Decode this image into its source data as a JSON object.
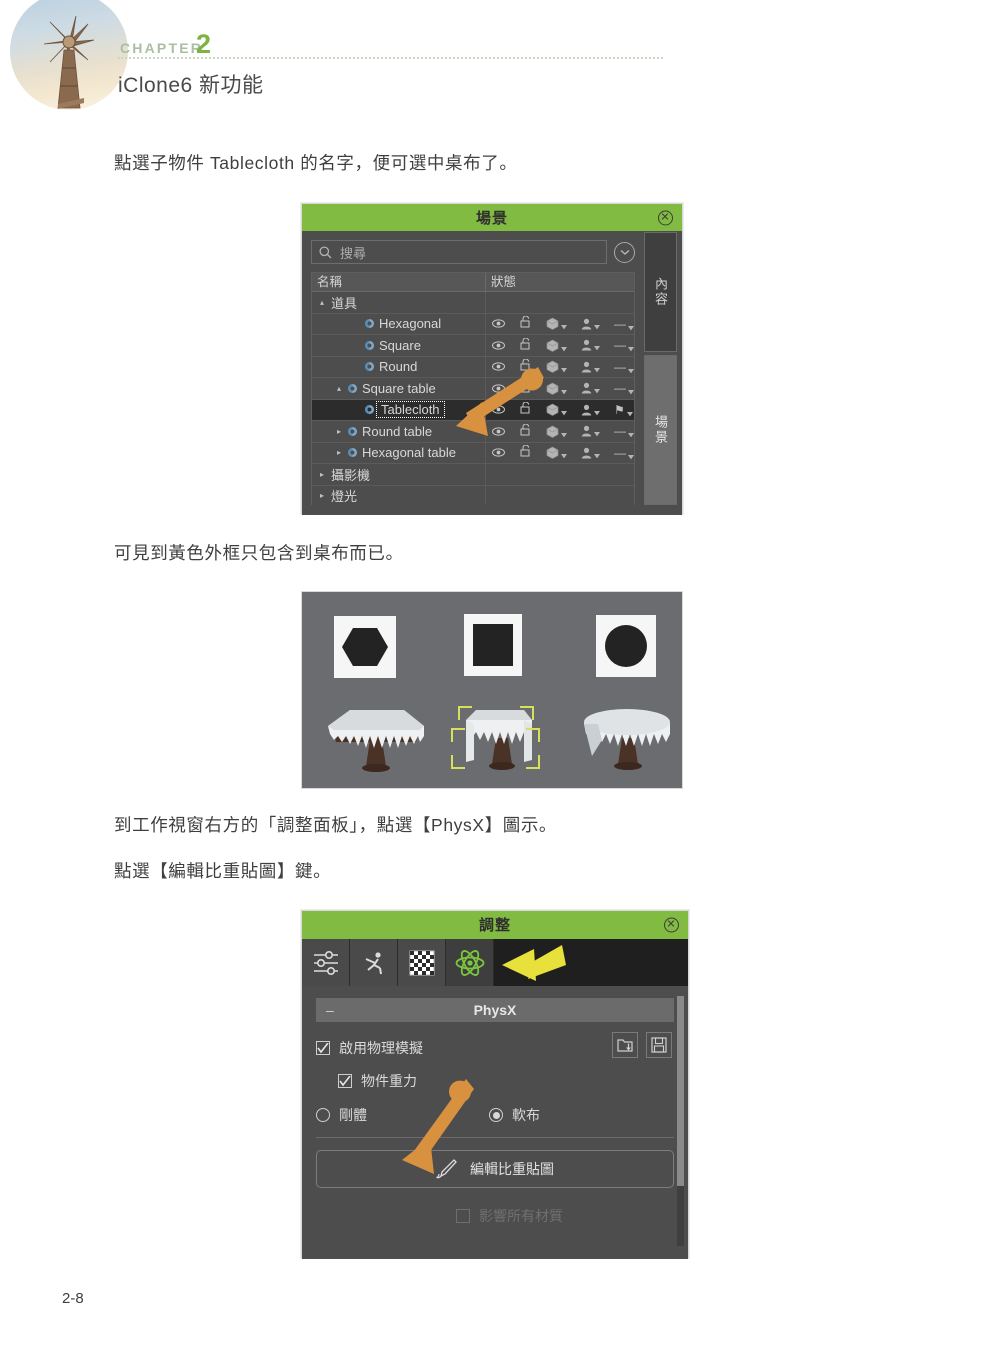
{
  "header": {
    "chapter_word": "CHAPTER",
    "chapter_number": "2",
    "title": "iClone6 新功能",
    "accent_green": "#7cb342",
    "rule_color": "#c9d8c2"
  },
  "paragraphs": {
    "p1": "點選子物件 Tablecloth 的名字，便可選中桌布了。",
    "p2": "可見到黃色外框只包含到桌布而已。",
    "p3": "到工作視窗右方的「調整面板」，點選【PhysX】圖示。",
    "p4": "點選【編輯比重貼圖】鍵。"
  },
  "scene_panel": {
    "title": "場景",
    "close_label": "✕",
    "search": {
      "placeholder": "搜尋",
      "value": ""
    },
    "columns": [
      "名稱",
      "狀態"
    ],
    "rows": [
      {
        "label": "道具",
        "depth": 0,
        "twisty": "▴",
        "has_prop_icon": false,
        "selected": false,
        "editing": false,
        "status": false,
        "last_icon": ""
      },
      {
        "label": "Hexagonal",
        "depth": 2,
        "twisty": "",
        "has_prop_icon": true,
        "selected": false,
        "editing": false,
        "status": true,
        "last_icon": "—"
      },
      {
        "label": "Square",
        "depth": 2,
        "twisty": "",
        "has_prop_icon": true,
        "selected": false,
        "editing": false,
        "status": true,
        "last_icon": "—"
      },
      {
        "label": "Round",
        "depth": 2,
        "twisty": "",
        "has_prop_icon": true,
        "selected": false,
        "editing": false,
        "status": true,
        "last_icon": "—"
      },
      {
        "label": "Square table",
        "depth": 1,
        "twisty": "▴",
        "has_prop_icon": true,
        "selected": false,
        "editing": false,
        "status": true,
        "last_icon": "—"
      },
      {
        "label": "Tablecloth",
        "depth": 2,
        "twisty": "",
        "has_prop_icon": true,
        "selected": true,
        "editing": true,
        "status": true,
        "last_icon": "⚑"
      },
      {
        "label": "Round table",
        "depth": 1,
        "twisty": "▸",
        "has_prop_icon": true,
        "selected": false,
        "editing": false,
        "status": true,
        "last_icon": "—"
      },
      {
        "label": "Hexagonal table",
        "depth": 1,
        "twisty": "▸",
        "has_prop_icon": true,
        "selected": false,
        "editing": false,
        "status": true,
        "last_icon": "—"
      },
      {
        "label": "攝影機",
        "depth": 0,
        "twisty": "▸",
        "has_prop_icon": false,
        "selected": false,
        "editing": false,
        "status": false,
        "last_icon": ""
      },
      {
        "label": "燈光",
        "depth": 0,
        "twisty": "▸",
        "has_prop_icon": false,
        "selected": false,
        "editing": false,
        "status": false,
        "last_icon": ""
      }
    ],
    "side_tabs": [
      {
        "label": "內容",
        "active": false
      },
      {
        "label": "場景",
        "active": true
      }
    ],
    "status_icons": [
      "eye-icon",
      "unlock-icon",
      "mesh-cube-icon",
      "avatar-icon"
    ]
  },
  "viewport": {
    "background": "#6a6c70",
    "texture_cards": [
      "hexagon-map",
      "square-map",
      "circle-map"
    ],
    "tables": [
      "hexagonal-table",
      "square-table-selected",
      "round-table"
    ],
    "selection_color": "#d7e05a"
  },
  "adjust_panel": {
    "title": "調整",
    "close_label": "✕",
    "tabs": [
      {
        "name": "sliders-icon",
        "active": false
      },
      {
        "name": "motion-icon",
        "active": false
      },
      {
        "name": "checkerboard-icon",
        "active": false
      },
      {
        "name": "atom-physx-icon",
        "active": true
      }
    ],
    "section": {
      "label": "PhysX",
      "collapse_glyph": "–"
    },
    "checkboxes": [
      {
        "label": "啟用物理模擬",
        "checked": true,
        "dim": false
      },
      {
        "label": "物件重力",
        "checked": true,
        "dim": false
      },
      {
        "label": "影響所有材質",
        "checked": false,
        "dim": true
      }
    ],
    "io_buttons": [
      "load-icon",
      "save-icon"
    ],
    "radios": [
      {
        "label": "剛體",
        "selected": false
      },
      {
        "label": "軟布",
        "selected": true
      }
    ],
    "edit_button": {
      "label": "編輯比重貼圖",
      "icon": "brush-icon"
    },
    "arrow_color": "#e8e13c"
  },
  "footer": {
    "page_number": "2-8"
  }
}
